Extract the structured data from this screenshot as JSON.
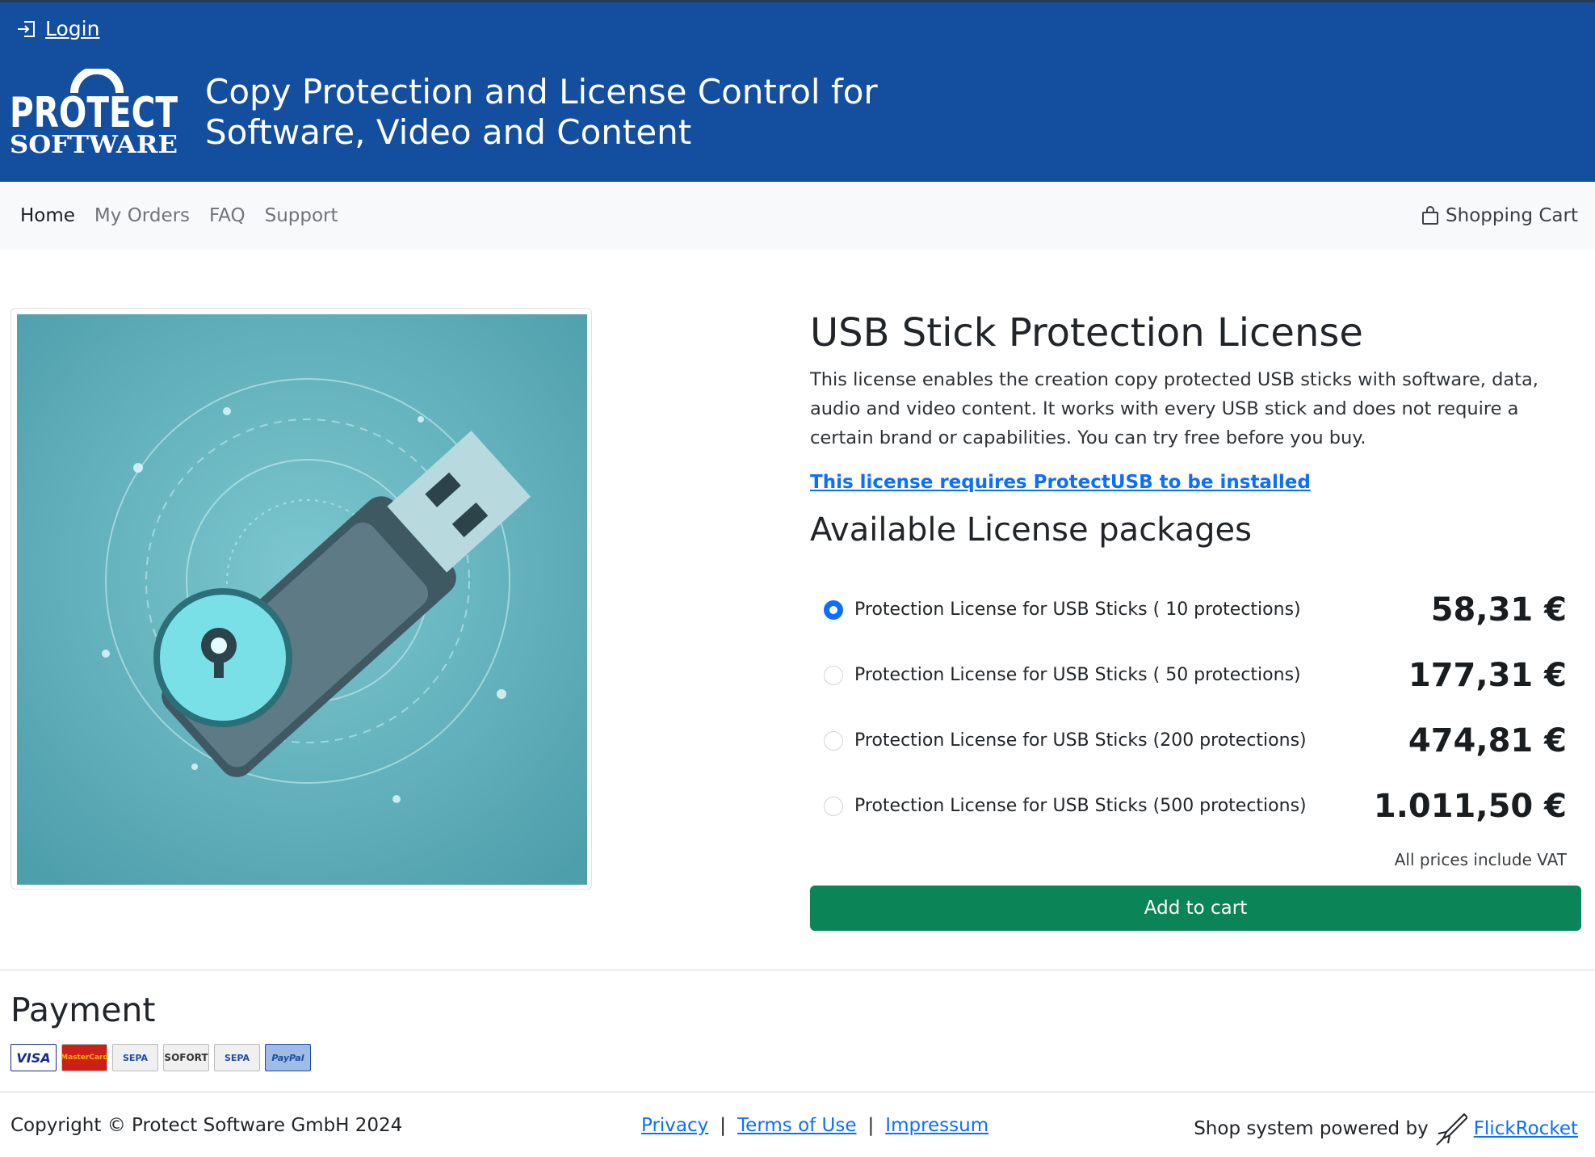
{
  "header": {
    "login_label": "Login",
    "logo_line1": "PROTECT",
    "logo_line2": "SOFTWARE",
    "tagline_line1": "Copy Protection and License Control for",
    "tagline_line2": "Software, Video and Content"
  },
  "nav": {
    "items": [
      {
        "label": "Home",
        "active": true
      },
      {
        "label": "My Orders",
        "active": false
      },
      {
        "label": "FAQ",
        "active": false
      },
      {
        "label": "Support",
        "active": false
      }
    ],
    "cart_label": "Shopping Cart"
  },
  "product": {
    "title": "USB Stick Protection License",
    "description": "This license enables the creation copy protected USB sticks with software, data, audio and video content. It works with every USB stick and does not require a certain brand or capabilities. You can try free before you buy.",
    "requirement_link": "This license requires ProtectUSB to be installed",
    "packages_title": "Available License packages",
    "packages": [
      {
        "label": "Protection License for USB Sticks ( 10 protections)",
        "price": "58,31 €",
        "selected": true
      },
      {
        "label": "Protection License for USB Sticks ( 50 protections)",
        "price": "177,31 €",
        "selected": false
      },
      {
        "label": "Protection License for USB Sticks (200 protections)",
        "price": "474,81 €",
        "selected": false
      },
      {
        "label": "Protection License for USB Sticks (500 protections)",
        "price": "1.011,50 €",
        "selected": false
      }
    ],
    "vat_note": "All prices include VAT",
    "add_to_cart_label": "Add to cart"
  },
  "payment": {
    "title": "Payment",
    "methods": [
      "VISA",
      "MasterCard",
      "SEPA",
      "SOFORT",
      "SEPA",
      "PayPal"
    ]
  },
  "footer": {
    "copyright": "Copyright © Protect Software GmbH 2024",
    "links": [
      "Privacy",
      "Terms of Use",
      "Impressum"
    ],
    "separator": "|",
    "powered_by": "Shop system powered by",
    "powered_link": "FlickRocket"
  },
  "colors": {
    "header_bg": "#134e9f",
    "primary": "#0d6efd",
    "success": "#0b8558",
    "nav_bg": "#f8f9fa"
  }
}
